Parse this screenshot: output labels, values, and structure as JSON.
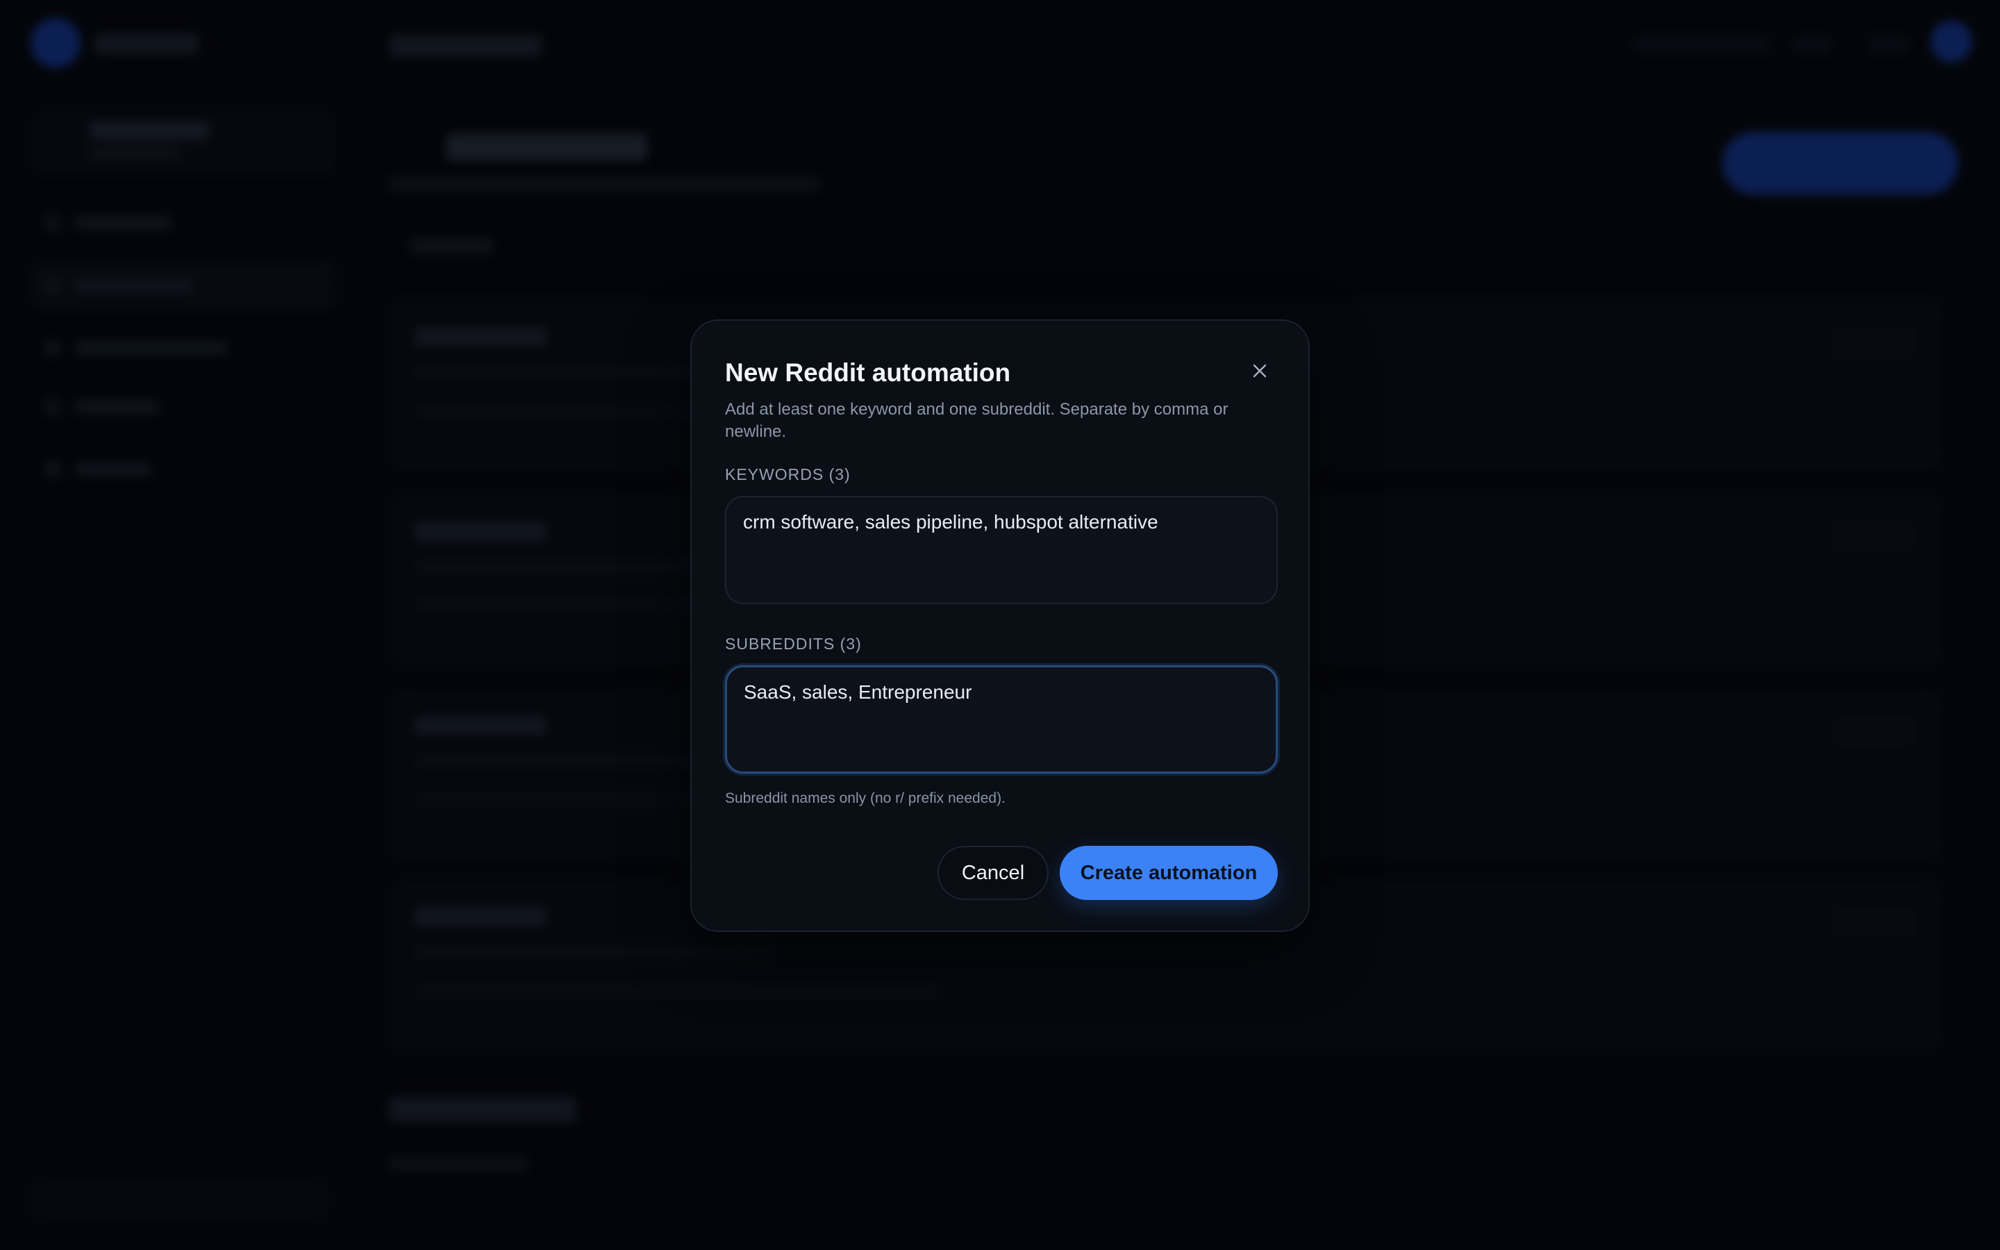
{
  "dialog": {
    "title": "New Reddit automation",
    "description": "Add at least one keyword and one subreddit. Separate by comma or newline.",
    "close_icon": "close-icon",
    "keywords": {
      "label": "KEYWORDS (3)",
      "value": "crm software, sales pipeline, hubspot alternative"
    },
    "subreddits": {
      "label": "SUBREDDITS (3)",
      "value": "SaaS, sales, Entrepreneur",
      "hint": "Subreddit names only (no r/ prefix needed)."
    },
    "cancel_label": "Cancel",
    "create_label": "Create automation"
  },
  "colors": {
    "accent": "#3b82f6",
    "background": "#05070b",
    "dialog_surface": "#0a0e15",
    "focus_ring": "#274a7d"
  }
}
